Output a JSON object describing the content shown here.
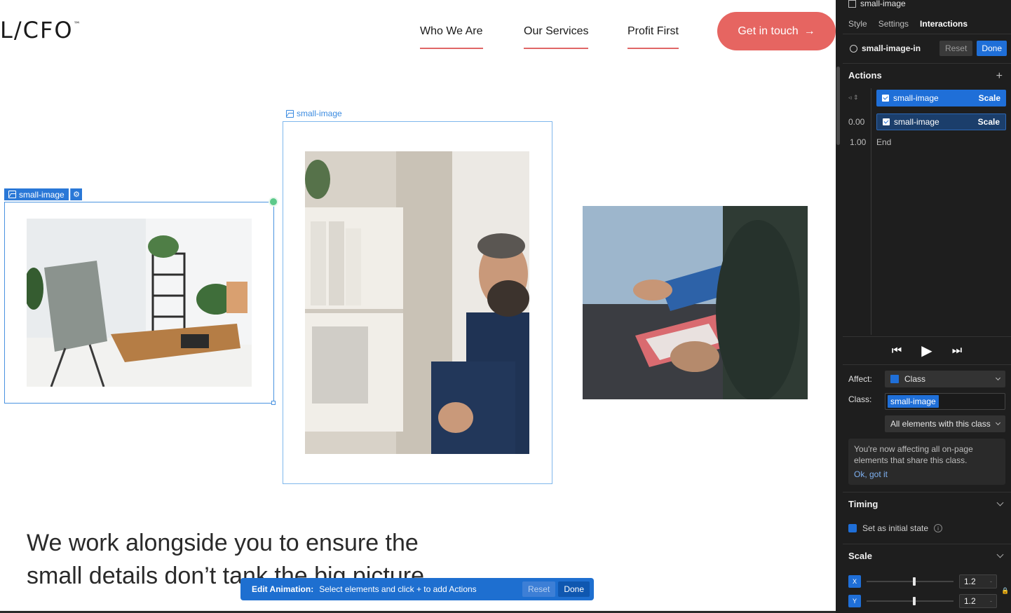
{
  "site": {
    "logo": "L/CFO",
    "logo_tm": "™",
    "nav": [
      "Who We Are",
      "Our Services",
      "Profit First"
    ],
    "cta_label": "Get in touch",
    "cta_arrow": "→",
    "heading_line1": "We work alongside you to ensure the",
    "heading_line2": "small details don’t tank the big picture",
    "brand_color": "#e66561"
  },
  "canvas": {
    "label_small": "small-image",
    "label_active": "small-image"
  },
  "anim_bar": {
    "title": "Edit Animation:",
    "message": "Select elements and click + to add Actions",
    "reset": "Reset",
    "done": "Done"
  },
  "panel": {
    "element_name": "small-image",
    "tabs": [
      "Style",
      "Settings",
      "Interactions"
    ],
    "active_tab": "Interactions",
    "interaction_name": "small-image-in",
    "reset": "Reset",
    "done": "Done",
    "actions_title": "Actions",
    "actions": [
      {
        "target": "small-image",
        "type": "Scale",
        "selected": true
      },
      {
        "target": "small-image",
        "type": "Scale",
        "selected": false
      }
    ],
    "times": [
      "0.00",
      "1.00"
    ],
    "end_label": "End",
    "affect_label": "Affect:",
    "affect_value": "Class",
    "class_label": "Class:",
    "class_value": "small-image",
    "scope_value": "All elements with this class",
    "info_text": "You're now affecting all on-page elements that share this class.",
    "info_link": "Ok, got it",
    "timing_title": "Timing",
    "initial_state_label": "Set as initial state",
    "scale_title": "Scale",
    "scale_x": "1.2",
    "scale_y": "1.2",
    "accent_color": "#1f6fd8"
  }
}
